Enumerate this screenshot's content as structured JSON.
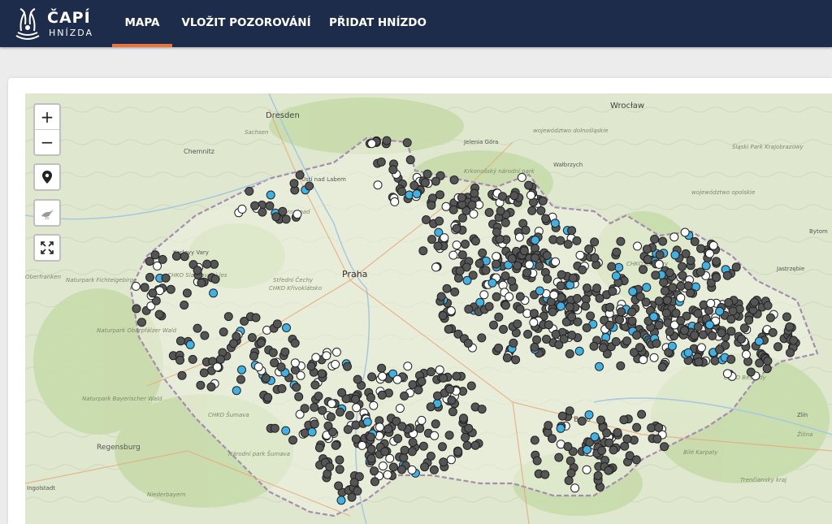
{
  "app": {
    "logo_line1": "ČAPÍ",
    "logo_line2": "HNÍZDA"
  },
  "nav": {
    "items": [
      {
        "label": "MAPA",
        "active": true
      },
      {
        "label": "VLOŽIT POZOROVÁNÍ",
        "active": false
      },
      {
        "label": "PŘIDAT HNÍZDO",
        "active": false
      }
    ],
    "accent_color": "#e8733b",
    "bar_color": "#1e2c4b"
  },
  "map_controls": {
    "zoom_in": "+",
    "zoom_out": "−",
    "locate_icon": "map-pin-icon",
    "layer_icon": "stork-icon",
    "fullscreen_icon": "fullscreen-icon"
  },
  "marker_colors": {
    "dark": "#555555",
    "white": "#ffffff",
    "blue": "#3fb1e5"
  },
  "labels": {
    "cities": [
      {
        "name": "Dresden"
      },
      {
        "name": "Wrocław"
      },
      {
        "name": "Praha"
      },
      {
        "name": "Chemnitz"
      },
      {
        "name": "Regensburg"
      },
      {
        "name": "Brno"
      },
      {
        "name": "Jelenia Góra"
      },
      {
        "name": "Wałbrzych"
      },
      {
        "name": "Karlovy Vary"
      },
      {
        "name": "Ústí nad Labem"
      },
      {
        "name": "Jastrzębie"
      },
      {
        "name": "Bytom"
      },
      {
        "name": "Zlín"
      },
      {
        "name": "Ingolstadt"
      }
    ],
    "regions": [
      {
        "name": "Sachsen"
      },
      {
        "name": "Severozápad"
      },
      {
        "name": "Střední Čechy"
      },
      {
        "name": "CHKO Křivoklátsko"
      },
      {
        "name": "CHKO Slavkovský les"
      },
      {
        "name": "CHKO Jeseníky"
      },
      {
        "name": "Krkonošský národní park"
      },
      {
        "name": "województwo dolnośląskie"
      },
      {
        "name": "województwo opolskie"
      },
      {
        "name": "Śląski Park Krajobrazowy"
      },
      {
        "name": "Oberfranken"
      },
      {
        "name": "Naturpark Fichtelgebirge"
      },
      {
        "name": "Naturpark Oberpfälzer Wald"
      },
      {
        "name": "Naturpark Bayerischer Wald"
      },
      {
        "name": "CHKO Šumava"
      },
      {
        "name": "Národní park Šumava"
      },
      {
        "name": "Niederbayern"
      },
      {
        "name": "CHKO Beskydy"
      },
      {
        "name": "Bílé Karpaty"
      },
      {
        "name": "Trenčiansky kraj"
      },
      {
        "name": "Žilina"
      }
    ]
  }
}
